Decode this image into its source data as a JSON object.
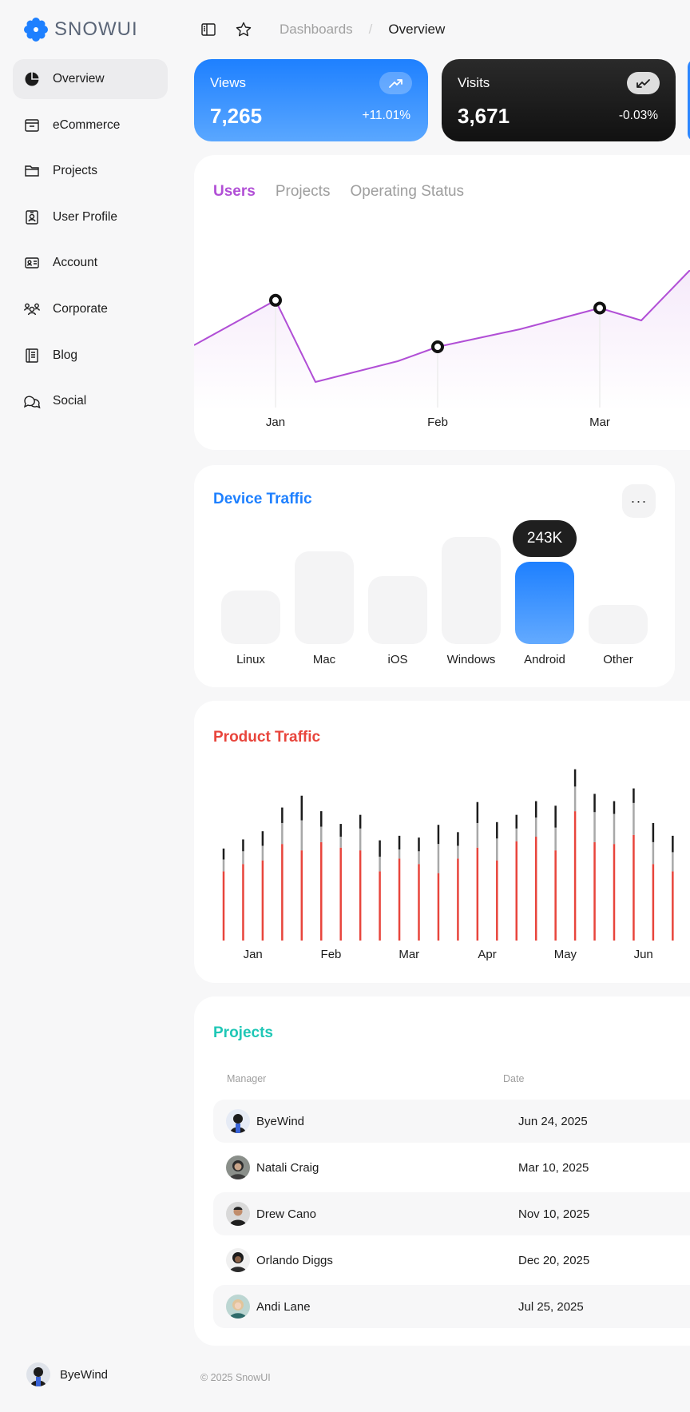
{
  "brand": {
    "name": "SNOWUI",
    "accent": "#1e80ff"
  },
  "sidebar": {
    "items": [
      {
        "label": "Overview",
        "icon": "pie-chart-icon",
        "active": true
      },
      {
        "label": "eCommerce",
        "icon": "archive-box-icon"
      },
      {
        "label": "Projects",
        "icon": "folder-icon"
      },
      {
        "label": "User Profile",
        "icon": "id-badge-icon"
      },
      {
        "label": "Account",
        "icon": "identification-card-icon"
      },
      {
        "label": "Corporate",
        "icon": "users-three-icon"
      },
      {
        "label": "Blog",
        "icon": "notebook-icon"
      },
      {
        "label": "Social",
        "icon": "chats-icon"
      }
    ],
    "user": {
      "name": "ByeWind"
    }
  },
  "topbar": {
    "breadcrumb": [
      "Dashboards",
      "Overview"
    ],
    "separator": "/"
  },
  "stats": [
    {
      "label": "Views",
      "value": "7,265",
      "change": "+11.01%",
      "trend": "up"
    },
    {
      "label": "Visits",
      "value": "3,671",
      "change": "-0.03%",
      "trend": "down"
    }
  ],
  "users_card": {
    "tabs": [
      "Users",
      "Projects",
      "Operating Status"
    ],
    "active_tab": "Users",
    "color": "#b14fd6"
  },
  "device_traffic": {
    "title": "Device Traffic",
    "color": "#1e80ff",
    "more": "···",
    "tooltip": "243K",
    "highlight": "Android"
  },
  "product_traffic": {
    "title": "Product Traffic",
    "color": "#e8453c"
  },
  "projects": {
    "title": "Projects",
    "color": "#1fc7b6",
    "columns": [
      "Manager",
      "Date"
    ],
    "rows": [
      {
        "manager": "ByeWind",
        "date": "Jun 24, 2025"
      },
      {
        "manager": "Natali Craig",
        "date": "Mar 10, 2025"
      },
      {
        "manager": "Drew Cano",
        "date": "Nov 10, 2025"
      },
      {
        "manager": "Orlando Diggs",
        "date": "Dec 20, 2025"
      },
      {
        "manager": "Andi Lane",
        "date": "Jul 25, 2025"
      }
    ]
  },
  "footer": {
    "text": "© 2025 SnowUI"
  },
  "chart_data": [
    {
      "type": "line",
      "categories": [
        "Jan",
        "Feb",
        "Mar"
      ],
      "series": [
        {
          "values": [
            12,
            6,
            11
          ]
        }
      ],
      "axis": "x labels only",
      "grid": false
    },
    {
      "type": "bar",
      "categories": [
        "Linux",
        "Mac",
        "iOS",
        "Windows",
        "Android",
        "Other"
      ],
      "values": [
        15,
        26,
        19,
        30,
        23,
        11
      ],
      "data_labels": {
        "Android": "243K"
      },
      "grid": false
    },
    {
      "type": "bar",
      "stacked": true,
      "categories": [
        "Jan",
        "Feb",
        "Mar",
        "Apr",
        "May",
        "Jun"
      ],
      "points_per_category": 4,
      "series_colors": [
        "#e8453c",
        "#a8a8a8",
        "#1c1c1c"
      ],
      "series": [
        {
          "values": [
            7.6,
            8.4,
            8.8,
            10.6,
            9.9,
            10.8,
            10.2,
            9.9,
            7.6,
            9.0,
            8.4,
            7.4,
            9.0,
            10.2,
            8.8,
            10.9,
            11.4,
            9.9,
            14.2,
            10.8,
            10.6,
            11.6,
            8.4,
            7.6
          ]
        },
        {
          "values": [
            1.3,
            1.4,
            1.6,
            2.3,
            3.3,
            1.7,
            1.2,
            2.4,
            1.6,
            1.0,
            1.4,
            3.2,
            1.4,
            2.7,
            2.4,
            1.4,
            2.1,
            2.5,
            2.7,
            3.3,
            3.3,
            3.5,
            2.4,
            2.1
          ]
        },
        {
          "values": [
            1.2,
            1.3,
            1.6,
            1.7,
            2.7,
            1.7,
            1.4,
            1.5,
            1.8,
            1.5,
            1.5,
            2.1,
            1.5,
            2.3,
            1.8,
            1.5,
            1.8,
            2.4,
            1.9,
            2.0,
            1.4,
            1.6,
            2.1,
            1.8
          ]
        }
      ],
      "grid": false
    }
  ]
}
